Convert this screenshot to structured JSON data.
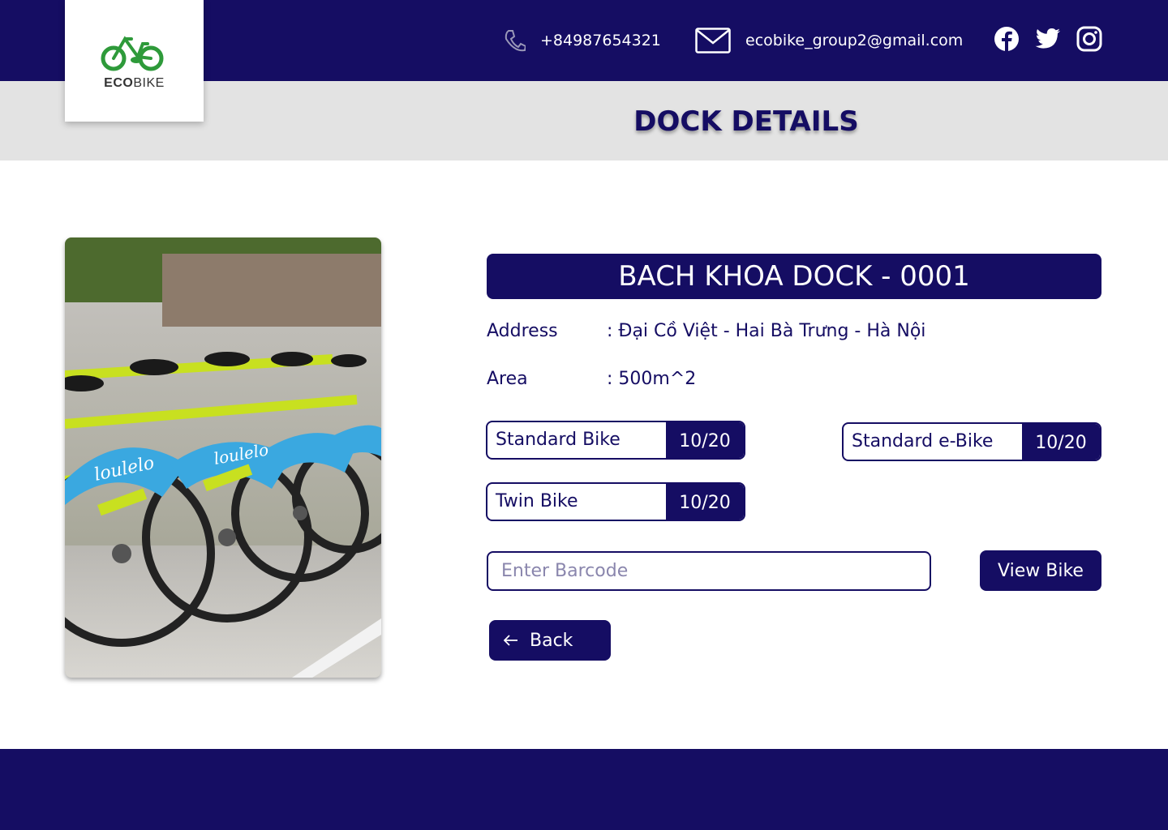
{
  "brand": {
    "name_bold": "ECO",
    "name_rest": "BIKE"
  },
  "header": {
    "phone": "+84987654321",
    "email": "ecobike_group2@gmail.com",
    "social": [
      "facebook-icon",
      "twitter-icon",
      "instagram-icon"
    ]
  },
  "page": {
    "title": "DOCK DETAILS"
  },
  "dock": {
    "name": "BACH KHOA DOCK - 0001",
    "address_label": "Address",
    "address_value": ": Đại Cồ Việt - Hai Bà Trưng - Hà Nội",
    "area_label": "Area",
    "area_value": ": 500m^2"
  },
  "bike_counts": [
    {
      "label": "Standard Bike",
      "value": "10/20"
    },
    {
      "label": "Standard e-Bike",
      "value": "10/20"
    },
    {
      "label": "Twin Bike",
      "value": "10/20"
    }
  ],
  "barcode": {
    "placeholder": "Enter Barcode"
  },
  "buttons": {
    "view_bike": "View Bike",
    "back": "Back"
  },
  "photo": {
    "brand_text": "loulelo"
  },
  "colors": {
    "primary": "#150d63",
    "subheader": "#e3e3e3",
    "logo_green": "#2e9a3a",
    "bike_yellow": "#c8e020",
    "bike_blue": "#3aa8e0"
  }
}
